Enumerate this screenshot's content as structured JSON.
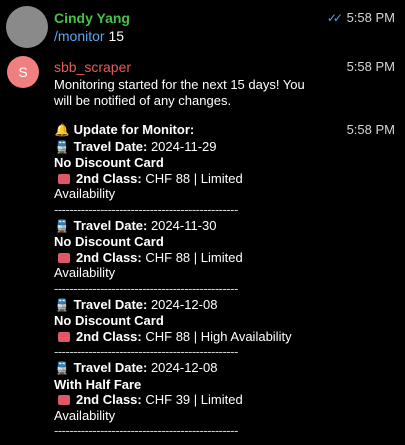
{
  "messages": [
    {
      "sender": "Cindy Yang",
      "sender_color": "#46c046",
      "time": "5:58 PM",
      "read_status": "double-check-icon",
      "command": "/monitor",
      "argument": "15"
    },
    {
      "sender": "sbb_scraper",
      "sender_color": "#e85b57",
      "avatar_letter": "S",
      "avatar_color": "#f08080",
      "time": "5:58 PM",
      "lines": [
        "Monitoring started for the next 15 days! You",
        "will be notified of any changes."
      ]
    },
    {
      "time": "5:58 PM",
      "header": "Update for Monitor:",
      "separator": "------------------------------------------------",
      "entries": [
        {
          "travel_date_label": "Travel Date:",
          "travel_date": "2024-11-29",
          "card": "No Discount Card",
          "class_label": "2nd Class:",
          "price": "CHF 88 | Limited",
          "price_cont": "Availability"
        },
        {
          "travel_date_label": "Travel Date:",
          "travel_date": "2024-11-30",
          "card": "No Discount Card",
          "class_label": "2nd Class:",
          "price": "CHF 88 | Limited",
          "price_cont": "Availability"
        },
        {
          "travel_date_label": "Travel Date:",
          "travel_date": "2024-12-08",
          "card": "No Discount Card",
          "class_label": "2nd Class:",
          "price": "CHF 88 | High Availability",
          "price_cont": ""
        },
        {
          "travel_date_label": "Travel Date:",
          "travel_date": "2024-12-08",
          "card": "With Half Fare",
          "class_label": "2nd Class:",
          "price": "CHF 39 | Limited",
          "price_cont": "Availability"
        }
      ]
    }
  ]
}
